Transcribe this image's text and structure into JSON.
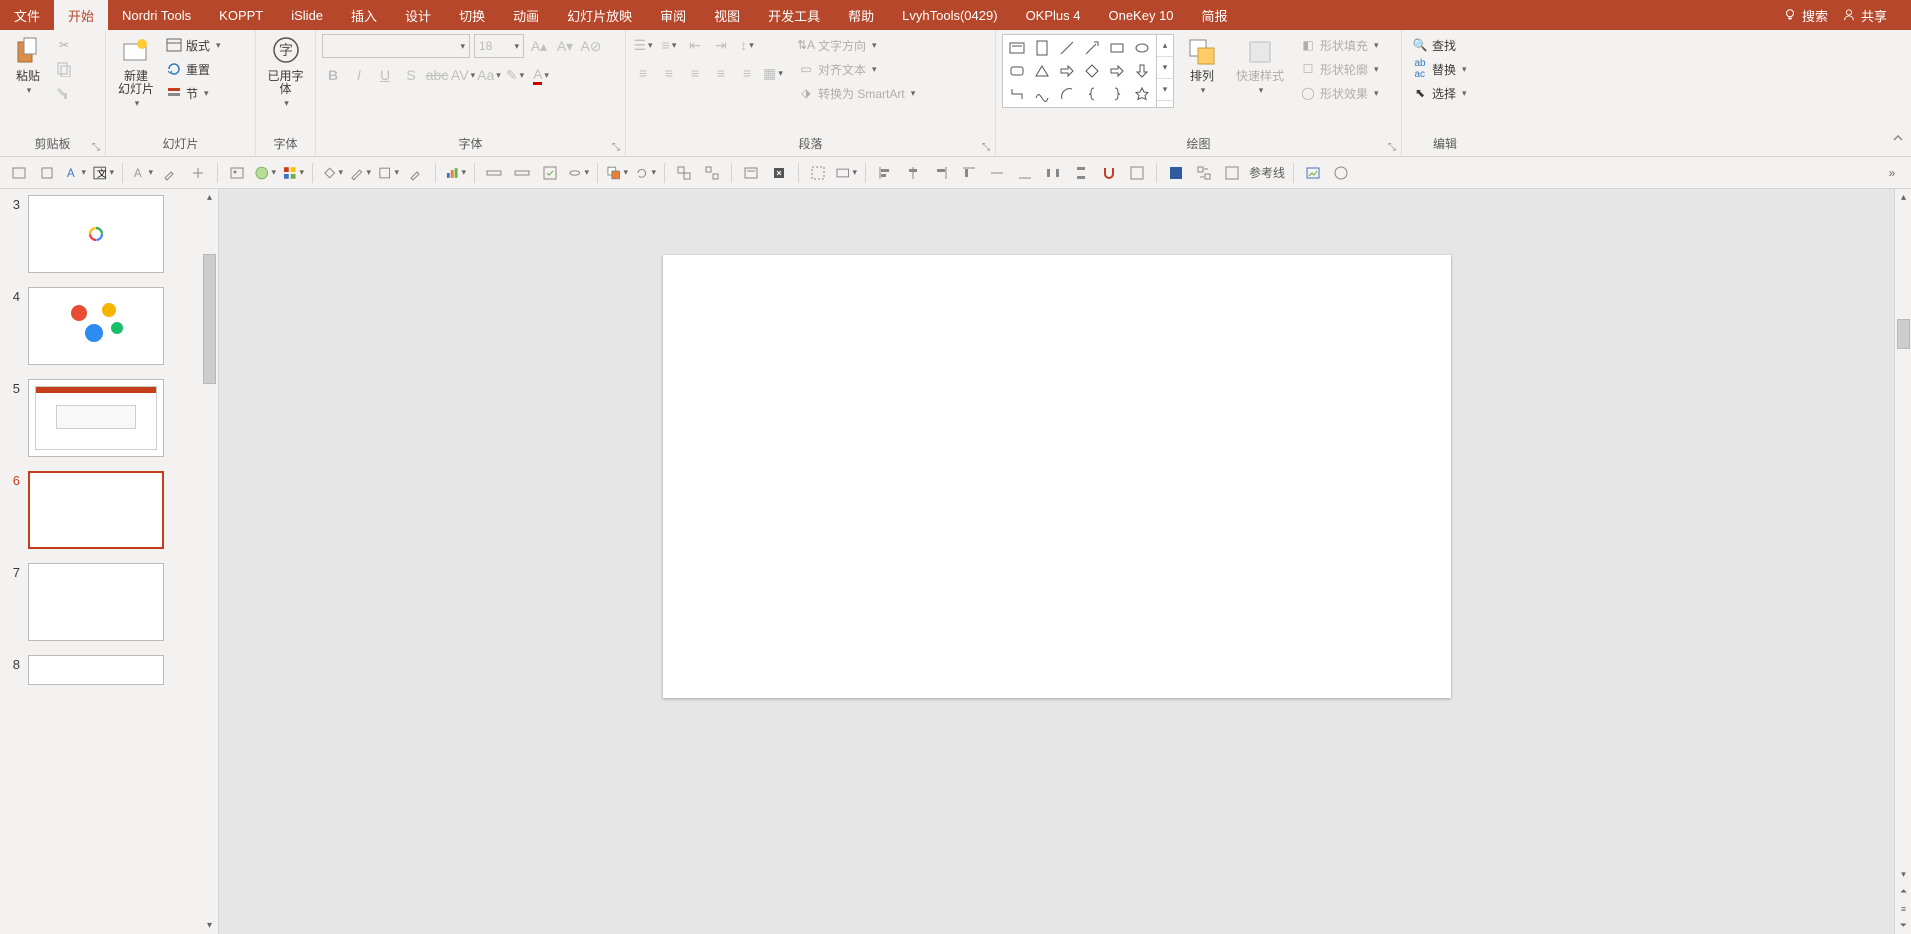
{
  "menubar": {
    "tabs": [
      {
        "id": "file",
        "label": "文件"
      },
      {
        "id": "home",
        "label": "开始"
      },
      {
        "id": "nordri",
        "label": "Nordri Tools"
      },
      {
        "id": "koppt",
        "label": "KOPPT"
      },
      {
        "id": "islide",
        "label": "iSlide"
      },
      {
        "id": "insert",
        "label": "插入"
      },
      {
        "id": "design",
        "label": "设计"
      },
      {
        "id": "transition",
        "label": "切换"
      },
      {
        "id": "animation",
        "label": "动画"
      },
      {
        "id": "slideshow",
        "label": "幻灯片放映"
      },
      {
        "id": "review",
        "label": "审阅"
      },
      {
        "id": "view",
        "label": "视图"
      },
      {
        "id": "devtools",
        "label": "开发工具"
      },
      {
        "id": "help",
        "label": "帮助"
      },
      {
        "id": "lvyh",
        "label": "LvyhTools(0429)"
      },
      {
        "id": "okplus",
        "label": "OKPlus 4"
      },
      {
        "id": "onekey",
        "label": "OneKey 10"
      },
      {
        "id": "brief",
        "label": "简报"
      }
    ],
    "active": "home",
    "search": "搜索",
    "share": "共享"
  },
  "ribbon": {
    "clipboard": {
      "label": "剪贴板",
      "paste": "粘贴",
      "cut": "剪切",
      "copy": "复制",
      "format_painter": "格式刷"
    },
    "slides": {
      "label": "幻灯片",
      "new_slide": "新建\n幻灯片",
      "layout": "版式",
      "reset": "重置",
      "section": "节"
    },
    "usedfont": {
      "label": "字体",
      "btn": "已用字\n体"
    },
    "font": {
      "label": "字体",
      "font_name": "",
      "font_size": "18"
    },
    "paragraph": {
      "label": "段落",
      "text_direction": "文字方向",
      "align_text": "对齐文本",
      "convert_smartart": "转换为 SmartArt"
    },
    "drawing": {
      "label": "绘图",
      "arrange": "排列",
      "quick_styles": "快速样式",
      "shape_fill": "形状填充",
      "shape_outline": "形状轮廓",
      "shape_effects": "形状效果"
    },
    "editing": {
      "label": "编辑",
      "find": "查找",
      "replace": "替换",
      "select": "选择"
    }
  },
  "toolbar2": {
    "guides": "参考线"
  },
  "slides_panel": {
    "items": [
      {
        "num": "3"
      },
      {
        "num": "4"
      },
      {
        "num": "5"
      },
      {
        "num": "6"
      },
      {
        "num": "7"
      },
      {
        "num": "8"
      }
    ],
    "active_index": 3
  },
  "colors": {
    "brand": "#b7472a",
    "accent": "#c43e1c"
  }
}
